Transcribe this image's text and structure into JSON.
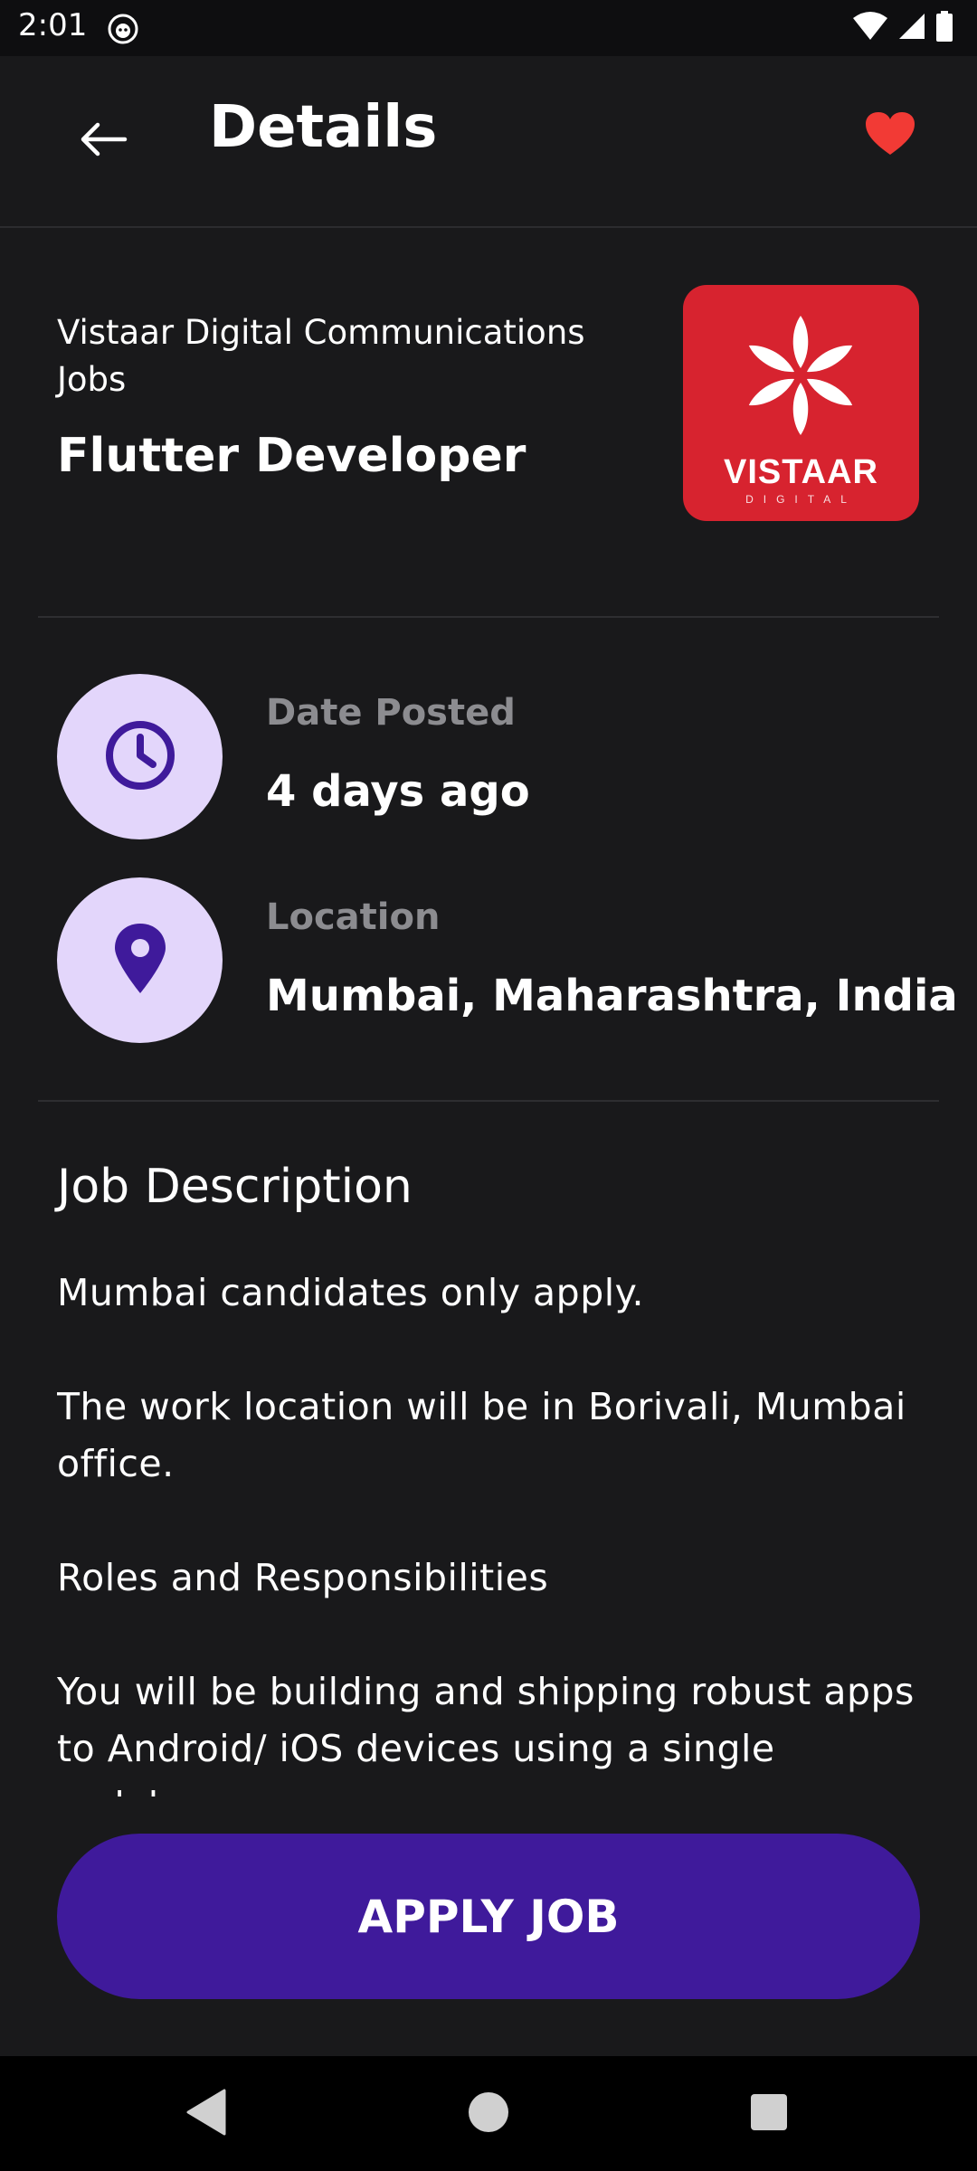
{
  "status_bar": {
    "time": "2:01"
  },
  "app_bar": {
    "title": "Details"
  },
  "job": {
    "company": "Vistaar Digital Communications Jobs",
    "title": "Flutter Developer",
    "logo_text": "VISTAAR",
    "logo_subtext": "DIGITAL"
  },
  "info": [
    {
      "label": "Date Posted",
      "value": "4 days ago",
      "icon": "clock-icon"
    },
    {
      "label": "Location",
      "value": "Mumbai, Maharashtra, India",
      "icon": "location-pin-icon"
    }
  ],
  "description": {
    "heading": "Job Description",
    "paragraphs": [
      "Mumbai candidates only apply.",
      "The work location will be in Borivali, Mumbai office.",
      "Roles and Responsibilities",
      "You will be building and shipping robust apps to Android/ iOS devices using a single codebase."
    ]
  },
  "apply_button": {
    "label": "APPLY JOB"
  },
  "colors": {
    "background": "#19191b",
    "accent": "#3f1a9b",
    "icon_circle": "#e3d6fb",
    "icon_color": "#3f1a9b",
    "favorite": "#f23a35",
    "logo_background": "#d7232f",
    "muted_label": "#8c8c90"
  }
}
